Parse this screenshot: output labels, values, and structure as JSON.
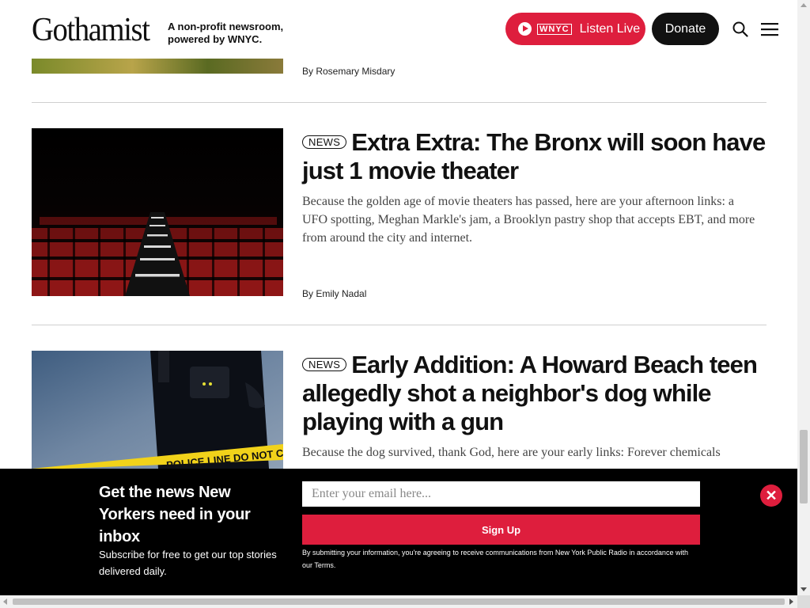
{
  "header": {
    "logo": "Gothamist",
    "tagline": "A non-profit newsroom, powered by WNYC.",
    "listen_live": {
      "brand": "WNYC",
      "label": "Listen Live"
    },
    "donate": "Donate",
    "icons": {
      "search": "search-icon",
      "menu": "hamburger-menu-icon",
      "play": "play-icon"
    }
  },
  "articles": [
    {
      "byline": "By Rosemary Misdary"
    },
    {
      "tag": "NEWS",
      "headline": "Extra Extra: The Bronx will soon have just 1 movie theater",
      "summary": "Because the golden age of movie theaters has passed, here are your afternoon links: a UFO spotting, Meghan Markle's jam, a Brooklyn pastry shop that accepts EBT, and more from around the city and internet.",
      "byline": "By Emily Nadal"
    },
    {
      "tag": "NEWS",
      "headline": "Early Addition: A Howard Beach teen allegedly shot a neighbor's dog while playing with a gun",
      "summary": "Because the dog survived, thank God, here are your early links: Forever chemicals",
      "tape_text": "POLICE LINE DO NOT CROSS"
    }
  ],
  "newsletter": {
    "title": "Get the news New Yorkers need in your inbox",
    "subtitle": "Subscribe for free to get our top stories delivered daily.",
    "email_placeholder": "Enter your email here...",
    "signup": "Sign Up",
    "terms": "By submitting your information, you're agreeing to receive communications from New York Public Radio in accordance with our Terms.",
    "close_icon": "close-icon"
  },
  "colors": {
    "brand_red": "#de1e3d",
    "dark": "#111111"
  }
}
